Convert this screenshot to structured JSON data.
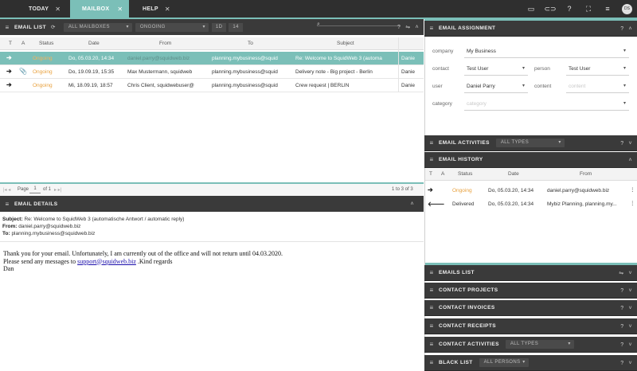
{
  "tabs": [
    {
      "label": "TODAY",
      "close": "✕"
    },
    {
      "label": "MAILBOX",
      "close": "✕"
    },
    {
      "label": "HELP",
      "close": "✕"
    }
  ],
  "user_initials": "DS",
  "email_list": {
    "title": "EMAIL LIST",
    "mailbox_filter": "ALL MAILBOXES",
    "status_filter": "ONGOING",
    "filter_1d": "1D",
    "filter_14": "14",
    "columns": {
      "type": "T",
      "attachment": "A",
      "status": "Status",
      "date": "Date",
      "from": "From",
      "to": "To",
      "subject": "Subject"
    },
    "rows": [
      {
        "status": "Ongoing",
        "date": "Do, 05.03.20, 14:34",
        "from": "daniel.parry@squidweb.biz",
        "to": "planning.mybusiness@squid",
        "subject": "Re: Welcome to SquidWeb 3 (automa",
        "owner": "Danie",
        "attachment": false
      },
      {
        "status": "Ongoing",
        "date": "Do, 19.09.19, 15:35",
        "from": "Max Mustermann, squidweb",
        "to": "planning.mybusiness@squid",
        "subject": "Delivery note - Big project - Berlin",
        "owner": "Danie",
        "attachment": true
      },
      {
        "status": "Ongoing",
        "date": "Mi, 18.09.19, 18:57",
        "from": "Chris Client, squidwebuser@",
        "to": "planning.mybusiness@squid",
        "subject": "Crew request | BERLIN",
        "owner": "Danie",
        "attachment": false
      }
    ],
    "pager": {
      "page_label": "Page",
      "page_value": "1",
      "of_label": "of 1",
      "count": "1 to 3 of 3"
    }
  },
  "email_details": {
    "title": "EMAIL DETAILS",
    "subject_label": "Subject:",
    "subject": "Re: Welcome to SquidWeb 3 (automatische Antwort / automatic reply)",
    "from_label": "From:",
    "from": "daniel.parry@squidweb.biz",
    "to_label": "To:",
    "to": "planning.mybusiness@squidweb.biz",
    "body_line1": "Thank you for your email. Unfortunately, I am currently out of the office and will not return until 04.03.2020.",
    "body_line2_pre": "Please send any messages to ",
    "body_link": "support@squidweb.biz",
    "body_line2_post": " .Kind regards",
    "body_line3": "Dan"
  },
  "assignment": {
    "title": "EMAIL ASSIGNMENT",
    "company_label": "company",
    "company_value": "My Business",
    "contact_label": "contact",
    "contact_value": "Test User",
    "person_label": "person",
    "person_value": "Test User",
    "user_label": "user",
    "user_value": "Daniel Parry",
    "content_label": "content",
    "content_placeholder": "content",
    "category_label": "category",
    "category_placeholder": "category"
  },
  "activities": {
    "title": "EMAIL ACTIVITIES",
    "filter": "ALL TYPES"
  },
  "history": {
    "title": "EMAIL HISTORY",
    "columns": {
      "type": "T",
      "attachment": "A",
      "status": "Status",
      "date": "Date",
      "from": "From"
    },
    "rows": [
      {
        "status": "Ongoing",
        "date": "Do, 05.03.20, 14:34",
        "from": "daniel.parry@squidweb.biz"
      },
      {
        "status": "Delivered",
        "date": "Do, 05.03.20, 14:34",
        "from": "Mybiz Planning, planning.my..."
      }
    ]
  },
  "side_panels": {
    "emails_list": "EMAILS LIST",
    "contact_projects": "CONTACT PROJECTS",
    "contact_invoices": "CONTACT INVOICES",
    "contact_receipts": "CONTACT RECEIPTS",
    "contact_activities": "CONTACT ACTIVITIES",
    "contact_activities_filter": "ALL TYPES",
    "black_list": "BLACK LIST",
    "black_list_filter": "ALL PERSONS"
  }
}
